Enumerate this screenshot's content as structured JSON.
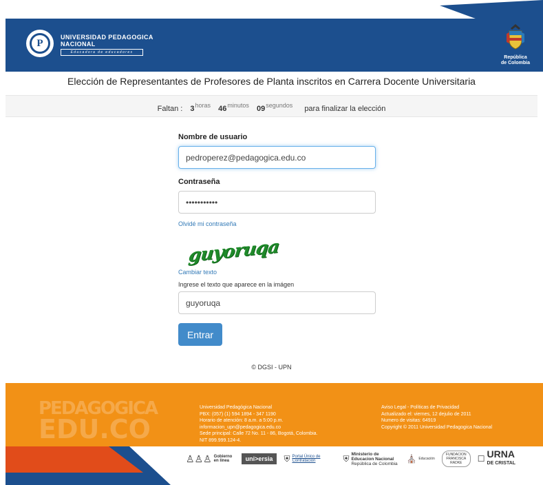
{
  "header": {
    "logo_line1": "UNIVERSIDAD PEDAGOGICA",
    "logo_line2": "NACIONAL",
    "logo_tagline": "Educadora de educadores",
    "coat_line1": "República",
    "coat_line2": "de Colombia"
  },
  "title": "Elección de Representantes de Profesores de Planta inscritos en Carrera Docente Universitaria",
  "countdown": {
    "prefix": "Faltan :",
    "hours": "3",
    "hours_unit": "horas",
    "minutes": "46",
    "minutes_unit": "minutos",
    "seconds": "09",
    "seconds_unit": "segundos",
    "suffix": "para finalizar la elección"
  },
  "login": {
    "username_label": "Nombre de usuario",
    "username_value": "pedroperez@pedagogica.edu.co",
    "password_label": "Contraseña",
    "password_value": "•••••••••••",
    "forgot_link": "Olvidé mi contraseña",
    "captcha_text": "guyoruqa",
    "change_text_link": "Cambiar texto",
    "captcha_label": "Ingrese el texto que aparece en la imágen",
    "captcha_value": "guyoruqa",
    "submit_label": "Entrar"
  },
  "copyright": "© DGSI - UPN",
  "footer": {
    "brand_line1": "PEDAGOGICA",
    "brand_line2": "EDU.CO",
    "info_lines": [
      "Universidad Pedagógica Nacional",
      "PBX: (057) (1) 594 1894 - 347 1190",
      "Horario de atención: 8 a.m. a 5:00 p.m.",
      "informacion_upn@pedagogica.edu.co",
      "Sede principal: Calle 72 No. 11 - 86, Bogotá, Colombia.",
      "NIT 899.999.124-4."
    ],
    "legal_lines": [
      "Aviso Legal - Políticas de Privacidad",
      "Actualizado el: viernes, 12 dejulio de 2011",
      "Numero de visitas: 64919",
      "Copyright © 2011 Universidad Pedagogica Nacional"
    ],
    "sponsors": {
      "gobierno": "Gobierno en línea",
      "universia": "uni>ersia",
      "contratacion": "Portal Único de Contratación",
      "ministerio": "Ministerio de Educacion Nacional",
      "ministerio_sub": "República de Colombia",
      "alcaldia": "Educación",
      "fundacion": "FUNDACION FRANCISCA RADKE",
      "urna": "URNA",
      "urna_sub": "DE CRISTAL"
    }
  },
  "colors": {
    "header_blue": "#1c4f8e",
    "footer_orange": "#f29116",
    "button_blue": "#428bca",
    "link_blue": "#337ab7"
  }
}
